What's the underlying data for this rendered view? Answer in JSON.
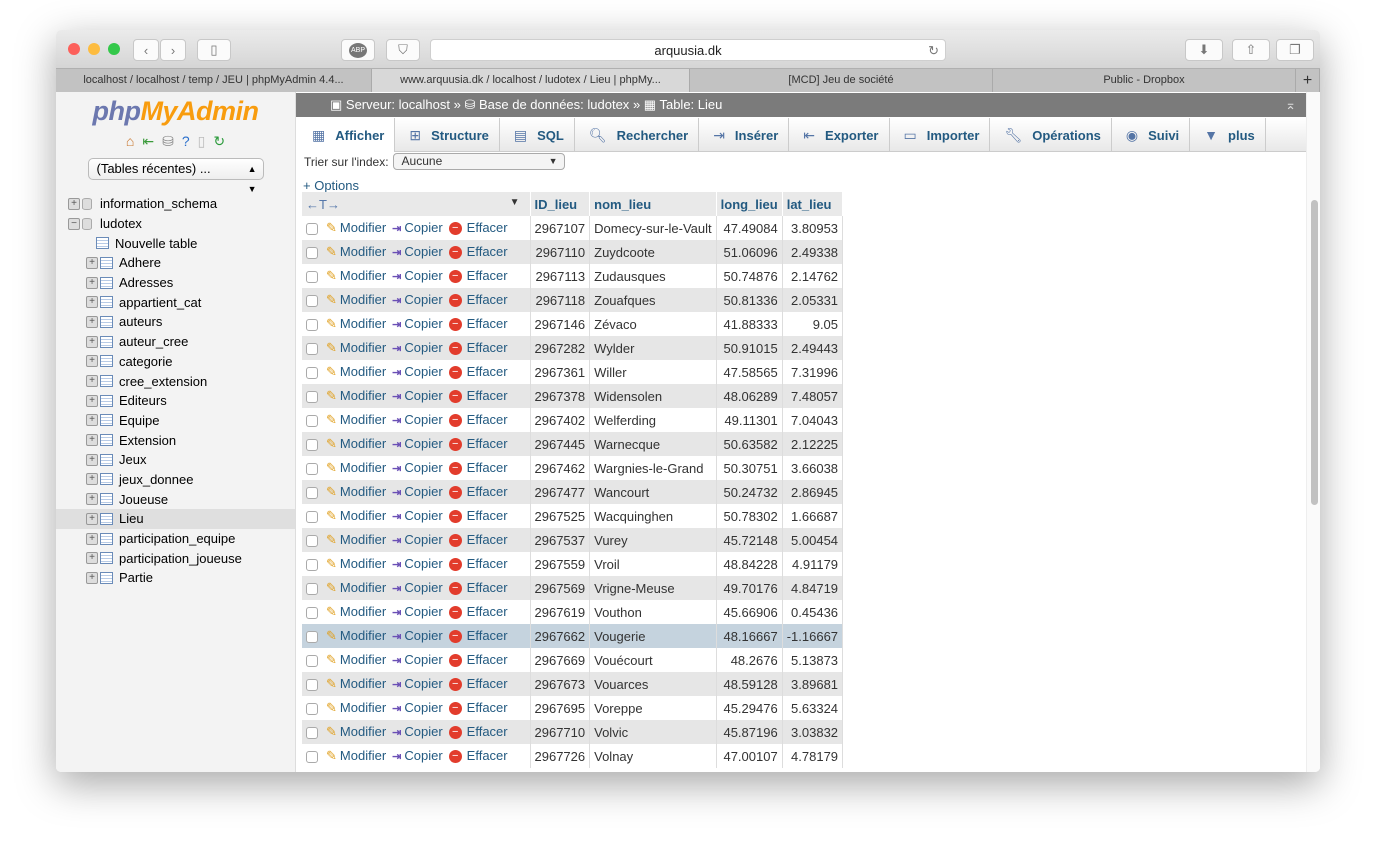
{
  "browser": {
    "url": "arquusia.dk",
    "tabs": [
      "localhost / localhost / temp / JEU | phpMyAdmin 4.4...",
      "www.arquusia.dk / localhost / ludotex / Lieu | phpMy...",
      "[MCD] Jeu de société",
      "Public - Dropbox"
    ],
    "active_tab": 1,
    "abp": "ABP"
  },
  "sidebar": {
    "logo_php": "php",
    "logo_myadmin": "MyAdmin",
    "recent": "(Tables récentes) ...",
    "databases": [
      {
        "name": "information_schema",
        "expanded": false
      },
      {
        "name": "ludotex",
        "expanded": true
      }
    ],
    "new_table": "Nouvelle table",
    "tables": [
      "Adhere",
      "Adresses",
      "appartient_cat",
      "auteurs",
      "auteur_cree",
      "categorie",
      "cree_extension",
      "Editeurs",
      "Equipe",
      "Extension",
      "Jeux",
      "jeux_donnee",
      "Joueuse",
      "Lieu",
      "participation_equipe",
      "participation_joueuse",
      "Partie"
    ],
    "selected": "Lieu"
  },
  "breadcrumb": {
    "server": "Serveur: localhost",
    "db": "Base de données: ludotex",
    "table": "Table: Lieu",
    "sep": "»"
  },
  "menu": [
    {
      "label": "Afficher",
      "icon": "table-icon"
    },
    {
      "label": "Structure",
      "icon": "structure-icon"
    },
    {
      "label": "SQL",
      "icon": "sql-icon"
    },
    {
      "label": "Rechercher",
      "icon": "search-icon"
    },
    {
      "label": "Insérer",
      "icon": "insert-icon"
    },
    {
      "label": "Exporter",
      "icon": "export-icon"
    },
    {
      "label": "Importer",
      "icon": "import-icon"
    },
    {
      "label": "Opérations",
      "icon": "wrench-icon"
    },
    {
      "label": "Suivi",
      "icon": "eye-icon"
    },
    {
      "label": "plus",
      "icon": "caret-down-icon"
    }
  ],
  "sort": {
    "label": "Trier sur l'index:",
    "value": "Aucune"
  },
  "options": "+ Options",
  "table": {
    "columns": [
      "ID_lieu",
      "nom_lieu",
      "long_lieu",
      "lat_lieu"
    ],
    "actions": {
      "edit": "Modifier",
      "copy": "Copier",
      "delete": "Effacer"
    },
    "highlighted_row": 17,
    "rows": [
      [
        "2967107",
        "Domecy-sur-le-Vault",
        "47.49084",
        "3.80953"
      ],
      [
        "2967110",
        "Zuydcoote",
        "51.06096",
        "2.49338"
      ],
      [
        "2967113",
        "Zudausques",
        "50.74876",
        "2.14762"
      ],
      [
        "2967118",
        "Zouafques",
        "50.81336",
        "2.05331"
      ],
      [
        "2967146",
        "Zévaco",
        "41.88333",
        "9.05"
      ],
      [
        "2967282",
        "Wylder",
        "50.91015",
        "2.49443"
      ],
      [
        "2967361",
        "Willer",
        "47.58565",
        "7.31996"
      ],
      [
        "2967378",
        "Widensolen",
        "48.06289",
        "7.48057"
      ],
      [
        "2967402",
        "Welferding",
        "49.11301",
        "7.04043"
      ],
      [
        "2967445",
        "Warnecque",
        "50.63582",
        "2.12225"
      ],
      [
        "2967462",
        "Wargnies-le-Grand",
        "50.30751",
        "3.66038"
      ],
      [
        "2967477",
        "Wancourt",
        "50.24732",
        "2.86945"
      ],
      [
        "2967525",
        "Wacquinghen",
        "50.78302",
        "1.66687"
      ],
      [
        "2967537",
        "Vurey",
        "45.72148",
        "5.00454"
      ],
      [
        "2967559",
        "Vroil",
        "48.84228",
        "4.91179"
      ],
      [
        "2967569",
        "Vrigne-Meuse",
        "49.70176",
        "4.84719"
      ],
      [
        "2967619",
        "Vouthon",
        "45.66906",
        "0.45436"
      ],
      [
        "2967662",
        "Vougerie",
        "48.16667",
        "-1.16667"
      ],
      [
        "2967669",
        "Vouécourt",
        "48.2676",
        "5.13873"
      ],
      [
        "2967673",
        "Vouarces",
        "48.59128",
        "3.89681"
      ],
      [
        "2967695",
        "Voreppe",
        "45.29476",
        "5.63324"
      ],
      [
        "2967710",
        "Volvic",
        "45.87196",
        "3.03832"
      ],
      [
        "2967726",
        "Volnay",
        "47.00107",
        "4.78179"
      ]
    ]
  }
}
